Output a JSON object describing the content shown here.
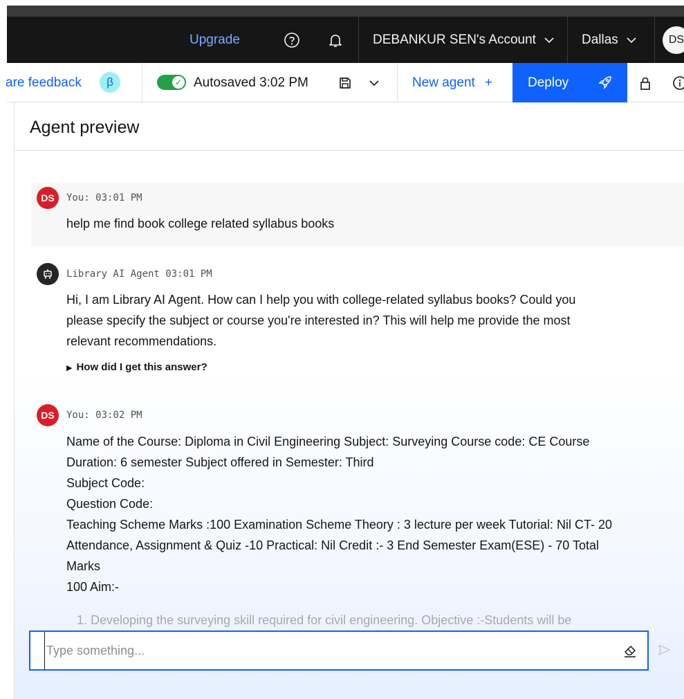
{
  "header": {
    "upgrade_label": "Upgrade",
    "account_label": "DEBANKUR SEN's Account",
    "region_label": "Dallas",
    "avatar_initials": "DS"
  },
  "toolbar": {
    "feedback_label": "are feedback",
    "beta_label": "β",
    "autosave_label": "Autosaved 3:02 PM",
    "new_agent_label": "New agent",
    "new_agent_plus": "+",
    "deploy_label": "Deploy"
  },
  "panel": {
    "title": "Agent preview"
  },
  "messages": [
    {
      "avatar": "DS",
      "meta": "You: 03:01 PM",
      "text": "help me find book college related syllabus books"
    },
    {
      "avatar_icon": "robot-icon",
      "meta": "Library AI Agent 03:01 PM",
      "lines": [
        "Hi, I am Library AI Agent. How can I help you with college-related syllabus books? Could you",
        "please specify the subject or course you're interested in? This will help me provide the most",
        "relevant recommendations."
      ],
      "link": "How did I get this answer?"
    },
    {
      "avatar": "DS",
      "meta": "You: 03:02 PM",
      "lines": [
        "Name of the Course: Diploma in Civil Engineering Subject: Surveying Course code: CE Course",
        "Duration: 6 semester Subject offered in Semester: Third",
        "Subject Code:",
        "Question Code:",
        "Teaching Scheme Marks :100 Examination Scheme Theory : 3 lecture per week Tutorial: Nil CT- 20",
        "Attendance, Assignment & Quiz -10 Practical: Nil Credit :- 3 End Semester Exam(ESE) - 70 Total",
        "Marks",
        "100 Aim:-"
      ],
      "fade": "1. Developing the surveying skill required for civil engineering. Objective :-Students will be"
    }
  ],
  "input": {
    "placeholder": "Type something..."
  }
}
